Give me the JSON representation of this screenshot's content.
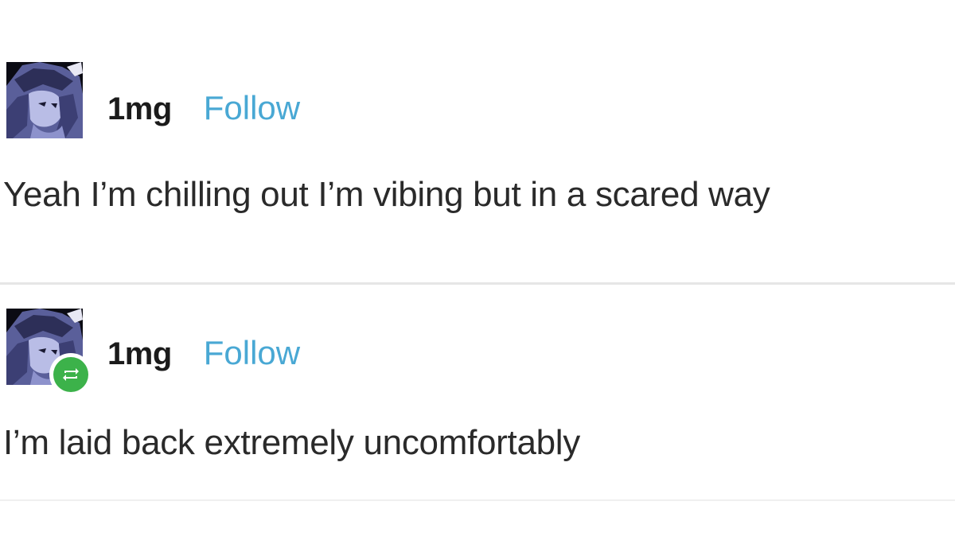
{
  "posts": [
    {
      "username": "1mg",
      "follow_label": "Follow",
      "text": "Yeah I’m chilling out I’m vibing but in a scared way",
      "reblogged": false
    },
    {
      "username": "1mg",
      "follow_label": "Follow",
      "text": "I’m laid back extremely uncomfortably",
      "reblogged": true
    }
  ],
  "colors": {
    "follow": "#49a8d4",
    "reblog_badge": "#3cb24a",
    "divider": "#e6e6e6"
  },
  "icons": {
    "avatar": "anime-avatar-icon",
    "reblog": "reblog-icon"
  }
}
